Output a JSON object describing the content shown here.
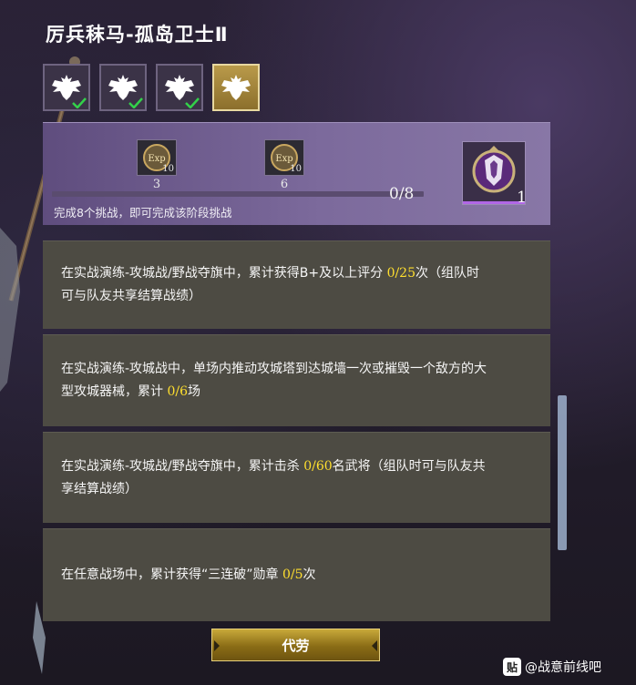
{
  "title": "厉兵秣马-孤岛卫士Ⅱ",
  "emblems": [
    {
      "icon": "eagle-emblem-icon",
      "completed": true
    },
    {
      "icon": "eagle-emblem-icon",
      "completed": true
    },
    {
      "icon": "eagle-emblem-icon",
      "completed": true
    },
    {
      "icon": "eagle-emblem-icon",
      "completed": false,
      "selected": true
    }
  ],
  "rewards": {
    "items": [
      {
        "icon": "exp-book-icon",
        "quantity": "10",
        "threshold": "3"
      },
      {
        "icon": "exp-book-icon",
        "quantity": "10",
        "threshold": "6"
      }
    ],
    "progress_text": "0/8",
    "progress_fraction": 0,
    "description": "完成8个挑战，即可完成该阶段挑战",
    "final_reward": {
      "icon": "shield-badge-icon",
      "quantity": "1"
    }
  },
  "tasks": [
    {
      "before": "在实战演练-攻城战/野战夺旗中，累计获得B+及以上评分 ",
      "progress": "0/25",
      "after": "次（组队时可与队友共享结算战绩）"
    },
    {
      "before": "在实战演练-攻城战中，单场内推动攻城塔到达城墙一次或摧毁一个敌方的大型攻城器械，累计 ",
      "progress": "0/6",
      "after": "场"
    },
    {
      "before": "在实战演练-攻城战/野战夺旗中，累计击杀 ",
      "progress": "0/60",
      "after": "名武将（组队时可与队友共享结算战绩）"
    },
    {
      "before": "在任意战场中，累计获得“三连破”勋章 ",
      "progress": "0/5",
      "after": "次"
    }
  ],
  "button_label": "代劳",
  "watermark": {
    "logo": "贴",
    "text": "@战意前线吧"
  },
  "colors": {
    "highlight": "#ffdf2e",
    "panel": "#4d4b43",
    "reward_panel": "#7c6a9c",
    "button": "#c8a93a"
  }
}
